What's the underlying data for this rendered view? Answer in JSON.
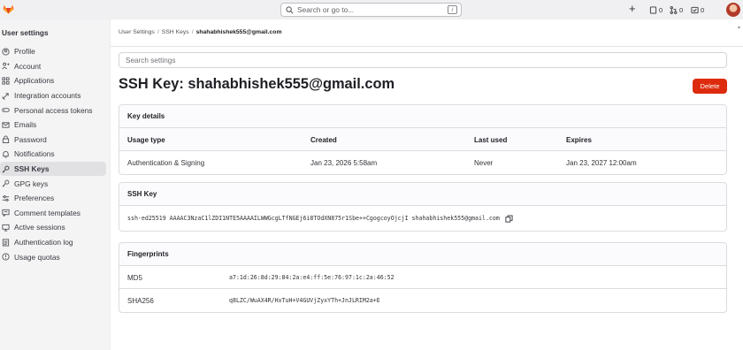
{
  "topbar": {
    "search_placeholder": "Search or go to...",
    "search_shortcut": "/",
    "issues_count": "0",
    "mr_count": "0",
    "todo_count": "0"
  },
  "sidebar": {
    "title": "User settings",
    "items": [
      {
        "label": "Profile",
        "icon": "profile-icon"
      },
      {
        "label": "Account",
        "icon": "account-icon"
      },
      {
        "label": "Applications",
        "icon": "applications-icon"
      },
      {
        "label": "Integration accounts",
        "icon": "integration-icon"
      },
      {
        "label": "Personal access tokens",
        "icon": "token-icon"
      },
      {
        "label": "Emails",
        "icon": "email-icon"
      },
      {
        "label": "Password",
        "icon": "lock-icon"
      },
      {
        "label": "Notifications",
        "icon": "bell-icon"
      },
      {
        "label": "SSH Keys",
        "icon": "key-icon",
        "active": true
      },
      {
        "label": "GPG keys",
        "icon": "key-icon"
      },
      {
        "label": "Preferences",
        "icon": "preferences-icon"
      },
      {
        "label": "Comment templates",
        "icon": "comment-icon"
      },
      {
        "label": "Active sessions",
        "icon": "monitor-icon"
      },
      {
        "label": "Authentication log",
        "icon": "log-icon"
      },
      {
        "label": "Usage quotas",
        "icon": "quota-icon"
      }
    ]
  },
  "breadcrumb": {
    "items": [
      "User Settings",
      "SSH Keys"
    ],
    "current": "shahabhishek555@gmail.com"
  },
  "settings_search_placeholder": "Search settings",
  "page_title": "SSH Key: shahabhishek555@gmail.com",
  "delete_label": "Delete",
  "key_details": {
    "heading": "Key details",
    "columns": [
      "Usage type",
      "Created",
      "Last used",
      "Expires"
    ],
    "values": [
      "Authentication & Signing",
      "Jan 23, 2026 5:58am",
      "Never",
      "Jan 23, 2027 12:00am"
    ]
  },
  "ssh_key": {
    "heading": "SSH Key",
    "value": "ssh-ed25519 AAAAC3NzaC1lZDI1NTE5AAAAILWWGcgLTfNGEj6i8TOdXN875r1Sbe++CgogcoyOjcjI shahabhishek555@gmail.com"
  },
  "fingerprints": {
    "heading": "Fingerprints",
    "rows": [
      {
        "label": "MD5",
        "value": "a7:1d:26:8d:29:84:2a:e4:ff:5e:76:97:1c:2a:46:52"
      },
      {
        "label": "SHA256",
        "value": "q8LZC/WuAX4R/HxTuH+V4GUVjZyxYTh+JnJLRIM2a+E"
      }
    ]
  },
  "colors": {
    "delete_button": "#dd2b0e",
    "sidebar_bg": "#f4f4f5",
    "active_item_bg": "#e1e1e4"
  }
}
